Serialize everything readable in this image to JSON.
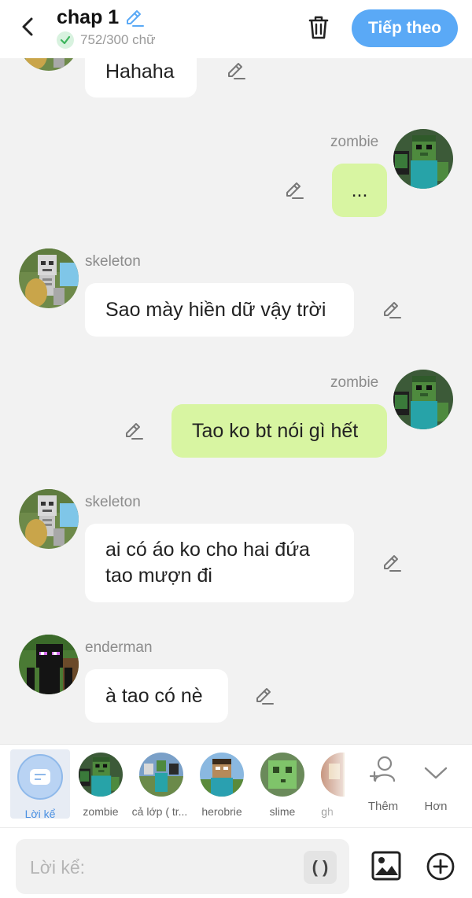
{
  "header": {
    "title": "chap 1",
    "char_count": "752/300 chữ",
    "next_label": "Tiếp theo"
  },
  "messages": [
    {
      "side": "left",
      "name": "",
      "text": "Hahaha",
      "avatar": "skeleton"
    },
    {
      "side": "right",
      "name": "zombie",
      "text": "...",
      "avatar": "zombie"
    },
    {
      "side": "left",
      "name": "skeleton",
      "text": "Sao mày hiền dữ vậy trời",
      "avatar": "skeleton"
    },
    {
      "side": "right",
      "name": "zombie",
      "text": "Tao ko bt nói gì hết",
      "avatar": "zombie"
    },
    {
      "side": "left",
      "name": "skeleton",
      "text_lines": [
        "ai có áo ko cho hai đứa",
        "tao mượn đi"
      ],
      "avatar": "skeleton"
    },
    {
      "side": "left",
      "name": "enderman",
      "text": "à tao có nè",
      "avatar": "enderman"
    }
  ],
  "character_bar": {
    "narration_label": "Lời kể",
    "characters": [
      {
        "label": "zombie",
        "icon": "zombie-avatar"
      },
      {
        "label": "cả lớp ( tr...",
        "icon": "class-avatar"
      },
      {
        "label": "herobrie",
        "icon": "herobrine-avatar"
      },
      {
        "label": "slime",
        "icon": "slime-avatar"
      },
      {
        "label": "gh",
        "icon": "partial-avatar"
      }
    ],
    "add_label": "Thêm",
    "more_label": "Hơn"
  },
  "input": {
    "placeholder": "Lời kể:",
    "paren_label": "( )"
  },
  "icons": {
    "back": "chevron-left-icon",
    "edit": "pencil-icon",
    "verified": "check-icon",
    "delete": "trash-icon",
    "image": "image-icon",
    "add": "plus-circle-icon",
    "add_person": "add-person-icon",
    "expand": "chevron-down-icon"
  },
  "colors": {
    "accent": "#5aa9f6",
    "my_bubble": "#d8f5a2",
    "their_bubble": "#ffffff",
    "background": "#f2f2f2",
    "verified": "#3cb45c"
  }
}
